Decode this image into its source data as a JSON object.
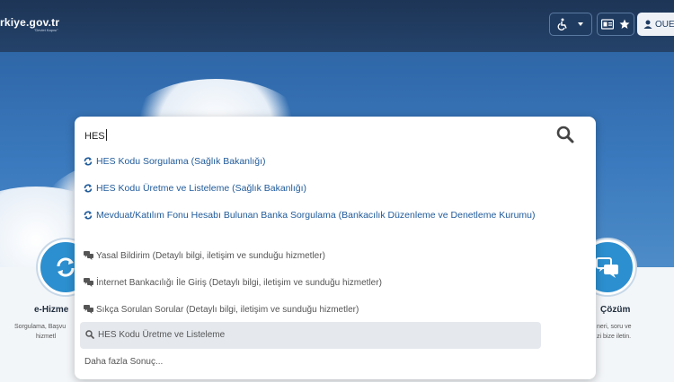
{
  "header": {
    "logo_text": "rkiye.gov.tr",
    "logo_sub": "\"Devlet Kapısı\"",
    "user_label": "OUE"
  },
  "side_left": {
    "title": "e-Hizme",
    "desc_line1": "Sorgulama, Başvu",
    "desc_line2": "hizmetl"
  },
  "side_right": {
    "title": "Çözüm",
    "desc_line1": "neri, soru ve",
    "desc_line2": "zi bize iletin."
  },
  "search": {
    "query": "HES",
    "suggestions": [
      {
        "text": "HES Kodu Sorgulama (Sağlık Bakanlığı)",
        "type": "service"
      },
      {
        "text": "HES Kodu Üretme ve Listeleme (Sağlık Bakanlığı)",
        "type": "service"
      },
      {
        "text": "Mevduat/Katılım Fonu Hesabı Bulunan Banka Sorgulama (Bankacılık Düzenleme ve Denetleme Kurumu)",
        "type": "service"
      },
      {
        "text": "Yasal Bildirim (Detaylı bilgi, iletişim ve sunduğu hizmetler)",
        "type": "chat"
      },
      {
        "text": "İnternet Bankacılığı İle Giriş (Detaylı bilgi, iletişim ve sunduğu hizmetler)",
        "type": "chat"
      },
      {
        "text": "Sıkça Sorulan Sorular (Detaylı bilgi, iletişim ve sunduğu hizmetler)",
        "type": "chat"
      }
    ],
    "recent": "HES Kodu Üretme ve Listeleme",
    "more": "Daha fazla Sonuç..."
  },
  "colors": {
    "header_bg": "#1d3556",
    "link": "#1f5a9a",
    "accent_circle": "#2c8fcf"
  }
}
